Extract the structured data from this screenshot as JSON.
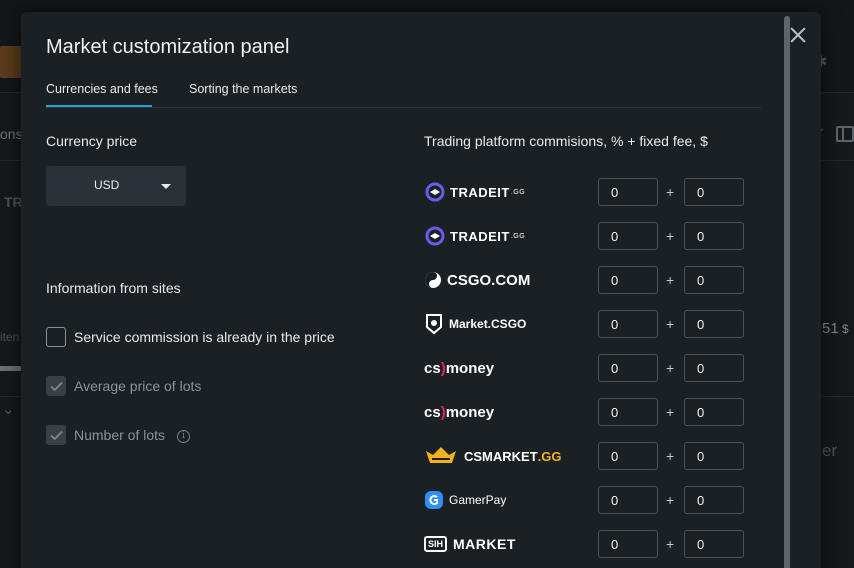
{
  "background": {
    "left_text_1": "ons",
    "left_text_2": "TR",
    "left_text_3": "iten",
    "right_text_price": "51",
    "right_text_currency": "$",
    "right_text_er": "er"
  },
  "modal": {
    "title": "Market customization panel",
    "close_icon": "close-icon",
    "tabs": [
      {
        "label": "Currencies and fees",
        "active": true
      },
      {
        "label": "Sorting the markets",
        "active": false
      }
    ]
  },
  "currency": {
    "label": "Currency price",
    "selected": "USD"
  },
  "info_section": {
    "label": "Information from sites",
    "options": [
      {
        "label": "Service commission is already in the price",
        "checked": false,
        "enabled": true
      },
      {
        "label": "Average price of lots",
        "checked": true,
        "enabled": false
      },
      {
        "label": "Number of lots",
        "checked": true,
        "enabled": false,
        "info_icon": "info-icon"
      }
    ]
  },
  "fees": {
    "label": "Trading platform commisions, % + fixed fee, $",
    "plus_sign": "+",
    "platforms": [
      {
        "name": "TRADEIT.GG",
        "logo_text": "TRADEIT",
        "logo_sup": ".GG",
        "percent": "0",
        "fixed": "0"
      },
      {
        "name": "TRADEIT.GG",
        "logo_text": "TRADEIT",
        "logo_sup": ".GG",
        "percent": "0",
        "fixed": "0"
      },
      {
        "name": "CSGO.COM",
        "logo_text": "CSGO.COM",
        "percent": "0",
        "fixed": "0"
      },
      {
        "name": "Market.CSGO",
        "logo_text": "Market.CSGO",
        "percent": "0",
        "fixed": "0"
      },
      {
        "name": "cs.money",
        "logo_text_a": "cs",
        "logo_paren": ")",
        "logo_text_b": "money",
        "percent": "0",
        "fixed": "0"
      },
      {
        "name": "cs.money",
        "logo_text_a": "cs",
        "logo_paren": ")",
        "logo_text_b": "money",
        "percent": "0",
        "fixed": "0"
      },
      {
        "name": "CSMARKET.GG",
        "logo_text_a": "CSMARKET",
        "logo_text_b": ".GG",
        "percent": "0",
        "fixed": "0"
      },
      {
        "name": "GamerPay",
        "logo_text": "GamerPay",
        "percent": "0",
        "fixed": "0"
      },
      {
        "name": "SIH MARKET",
        "logo_badge": "SIH",
        "logo_text": "MARKET",
        "percent": "0",
        "fixed": "0"
      }
    ]
  },
  "colors": {
    "accent": "#2e9fd8",
    "modal_bg": "#1b2024",
    "money_accent": "#e0256a",
    "csmarket_accent": "#f3b21c",
    "tradeit_accent": "#6a5cf0",
    "gamerpay_accent": "#2f8ff5"
  }
}
